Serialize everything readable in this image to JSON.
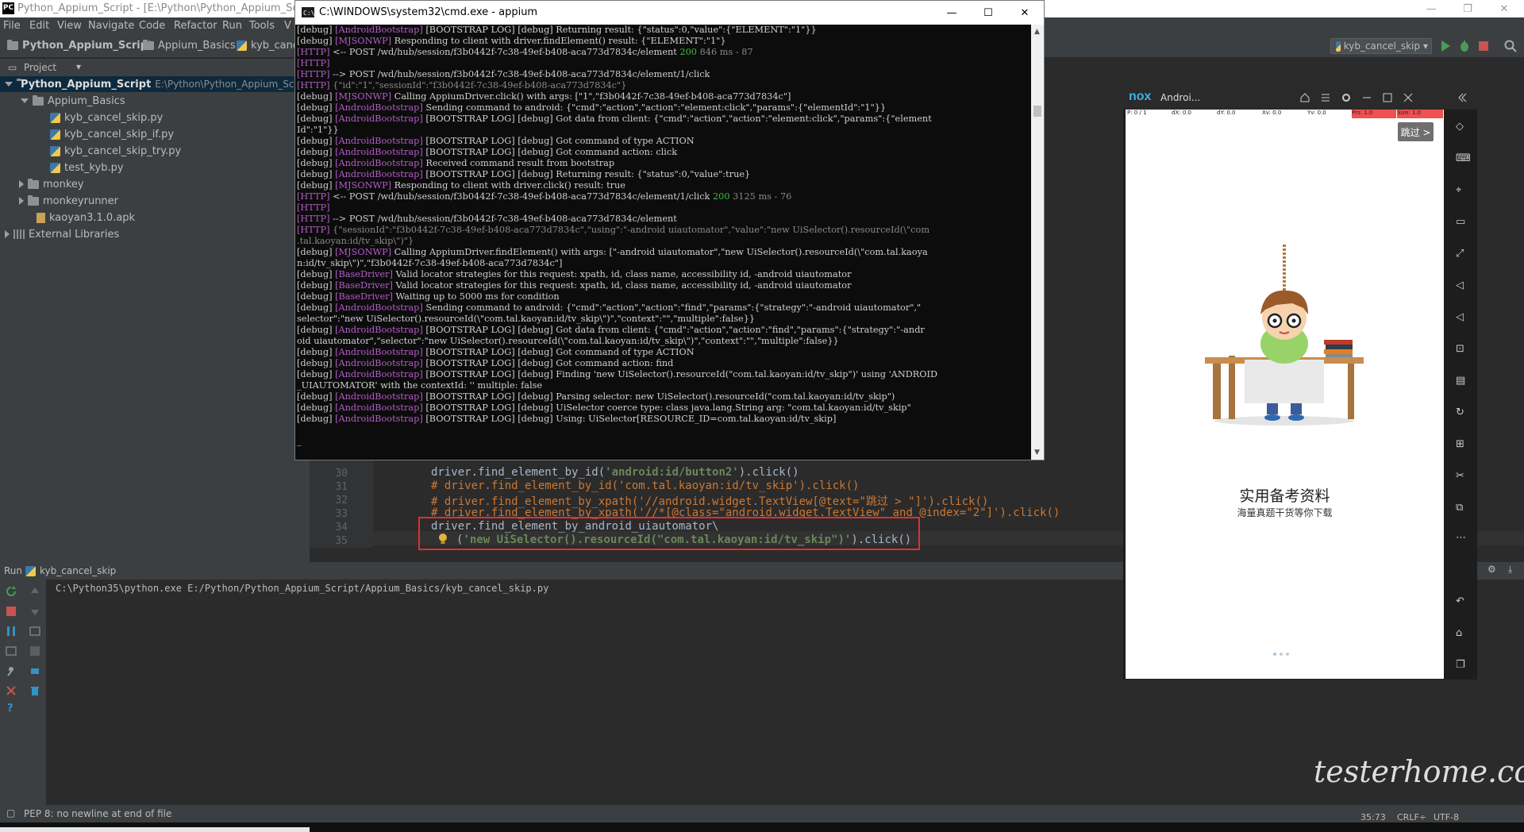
{
  "ide": {
    "title": "Python_Appium_Script - [E:\\Python\\Python_Appium_Script] - ...",
    "menu": [
      "File",
      "Edit",
      "View",
      "Navigate",
      "Code",
      "Refactor",
      "Run",
      "Tools",
      "V"
    ],
    "breadcrumbs": [
      "Python_Appium_Script",
      "Appium_Basics",
      "kyb_cance"
    ],
    "run_config": "kyb_cancel_skip",
    "project_label": "Project",
    "tree": {
      "root_name": "Python_Appium_Script",
      "root_path": "E:\\Python\\Python_Appium_Script",
      "folder1": "Appium_Basics",
      "files": [
        "kyb_cancel_skip.py",
        "kyb_cancel_skip_if.py",
        "kyb_cancel_skip_try.py",
        "test_kyb.py"
      ],
      "folder2": "monkey",
      "folder3": "monkeyrunner",
      "apk": "kaoyan3.1.0.apk",
      "external": "External Libraries"
    },
    "editor": {
      "line_numbers": [
        "30",
        "31",
        "32",
        "33",
        "34",
        "35"
      ],
      "line30_a": "driver.find_element_by_id(",
      "line30_str": "'android:id/button2'",
      "line30_b": ").click()",
      "line31": "# driver.find_element_by_id('com.tal.kaoyan:id/tv_skip').click()",
      "line32": "# driver.find_element_by_xpath('//android.widget.TextView[@text=\"跳过 > \"]').click()",
      "line33": "# driver.find_element_by_xpath('//*[@class=\"android.widget.TextView\" and @index=\"2\"]').click()",
      "line34": "driver.find_element_by_android_uiautomator\\",
      "line35_a": "(",
      "line35_str": "'new UiSelector().resourceId(\"com.tal.kaoyan:id/tv_skip\")'",
      "line35_b": ").click()"
    },
    "run": {
      "label": "Run",
      "config": "kyb_cancel_skip",
      "output": "C:\\Python35\\python.exe E:/Python/Python_Appium_Script/Appium_Basics/kyb_cancel_skip.py"
    },
    "status": {
      "message": "PEP 8: no newline at end of file",
      "position": "35:73",
      "line_sep": "CRLF÷",
      "encoding": "UTF-8"
    }
  },
  "cmd": {
    "title": "C:\\WINDOWS\\system32\\cmd.exe - appium",
    "lines": [
      [
        [
          "w",
          "[debug] "
        ],
        [
          "m",
          "[AndroidBootstrap]"
        ],
        [
          "w",
          " [BOOTSTRAP LOG] [debug] Returning result: {\"status\":0,\"value\":{\"ELEMENT\":\"1\"}}"
        ]
      ],
      [
        [
          "w",
          "[debug] "
        ],
        [
          "m",
          "[MJSONWP]"
        ],
        [
          "w",
          " Responding to client with driver.findElement() result: {\"ELEMENT\":\"1\"}"
        ]
      ],
      [
        [
          "m",
          "[HTTP]"
        ],
        [
          "w",
          " <-- POST /wd/hub/session/f3b0442f-7c38-49ef-b408-aca773d7834c/element "
        ],
        [
          "g",
          "200"
        ],
        [
          "d",
          " 846 ms - 87"
        ]
      ],
      [
        [
          "m",
          "[HTTP]"
        ]
      ],
      [
        [
          "m",
          "[HTTP]"
        ],
        [
          "w",
          " --> POST /wd/hub/session/f3b0442f-7c38-49ef-b408-aca773d7834c/element/1/click"
        ]
      ],
      [
        [
          "m",
          "[HTTP]"
        ],
        [
          "d",
          " {\"id\":\"1\",\"sessionId\":\"f3b0442f-7c38-49ef-b408-aca773d7834c\"}"
        ]
      ],
      [
        [
          "w",
          "[debug] "
        ],
        [
          "m",
          "[MJSONWP]"
        ],
        [
          "w",
          " Calling AppiumDriver.click() with args: [\"1\",\"f3b0442f-7c38-49ef-b408-aca773d7834c\"]"
        ]
      ],
      [
        [
          "w",
          "[debug] "
        ],
        [
          "m",
          "[AndroidBootstrap]"
        ],
        [
          "w",
          " Sending command to android: {\"cmd\":\"action\",\"action\":\"element:click\",\"params\":{\"elementId\":\"1\"}}"
        ]
      ],
      [
        [
          "w",
          "[debug] "
        ],
        [
          "m",
          "[AndroidBootstrap]"
        ],
        [
          "w",
          " [BOOTSTRAP LOG] [debug] Got data from client: {\"cmd\":\"action\",\"action\":\"element:click\",\"params\":{\"element"
        ]
      ],
      [
        [
          "w",
          "Id\":\"1\"}}"
        ]
      ],
      [
        [
          "w",
          "[debug] "
        ],
        [
          "m",
          "[AndroidBootstrap]"
        ],
        [
          "w",
          " [BOOTSTRAP LOG] [debug] Got command of type ACTION"
        ]
      ],
      [
        [
          "w",
          "[debug] "
        ],
        [
          "m",
          "[AndroidBootstrap]"
        ],
        [
          "w",
          " [BOOTSTRAP LOG] [debug] Got command action: click"
        ]
      ],
      [
        [
          "w",
          "[debug] "
        ],
        [
          "m",
          "[AndroidBootstrap]"
        ],
        [
          "w",
          " Received command result from bootstrap"
        ]
      ],
      [
        [
          "w",
          "[debug] "
        ],
        [
          "m",
          "[AndroidBootstrap]"
        ],
        [
          "w",
          " [BOOTSTRAP LOG] [debug] Returning result: {\"status\":0,\"value\":true}"
        ]
      ],
      [
        [
          "w",
          "[debug] "
        ],
        [
          "m",
          "[MJSONWP]"
        ],
        [
          "w",
          " Responding to client with driver.click() result: true"
        ]
      ],
      [
        [
          "m",
          "[HTTP]"
        ],
        [
          "w",
          " <-- POST /wd/hub/session/f3b0442f-7c38-49ef-b408-aca773d7834c/element/1/click "
        ],
        [
          "g",
          "200"
        ],
        [
          "d",
          " 3125 ms - 76"
        ]
      ],
      [
        [
          "m",
          "[HTTP]"
        ]
      ],
      [
        [
          "m",
          "[HTTP]"
        ],
        [
          "w",
          " --> POST /wd/hub/session/f3b0442f-7c38-49ef-b408-aca773d7834c/element"
        ]
      ],
      [
        [
          "m",
          "[HTTP]"
        ],
        [
          "d",
          " {\"sessionId\":\"f3b0442f-7c38-49ef-b408-aca773d7834c\",\"using\":\"-android uiautomator\",\"value\":\"new UiSelector().resourceId(\\\"com"
        ]
      ],
      [
        [
          "d",
          ".tal.kaoyan:id/tv_skip\\\")\"}"
        ]
      ],
      [
        [
          "w",
          "[debug] "
        ],
        [
          "m",
          "[MJSONWP]"
        ],
        [
          "w",
          " Calling AppiumDriver.findElement() with args: [\"-android uiautomator\",\"new UiSelector().resourceId(\\\"com.tal.kaoya"
        ]
      ],
      [
        [
          "w",
          "n:id/tv_skip\\\")\",\"f3b0442f-7c38-49ef-b408-aca773d7834c\"]"
        ]
      ],
      [
        [
          "w",
          "[debug] "
        ],
        [
          "m",
          "[BaseDriver]"
        ],
        [
          "w",
          " Valid locator strategies for this request: xpath, id, class name, accessibility id, -android uiautomator"
        ]
      ],
      [
        [
          "w",
          "[debug] "
        ],
        [
          "m",
          "[BaseDriver]"
        ],
        [
          "w",
          " Valid locator strategies for this request: xpath, id, class name, accessibility id, -android uiautomator"
        ]
      ],
      [
        [
          "w",
          "[debug] "
        ],
        [
          "m",
          "[BaseDriver]"
        ],
        [
          "w",
          " Waiting up to 5000 ms for condition"
        ]
      ],
      [
        [
          "w",
          "[debug] "
        ],
        [
          "m",
          "[AndroidBootstrap]"
        ],
        [
          "w",
          " Sending command to android: {\"cmd\":\"action\",\"action\":\"find\",\"params\":{\"strategy\":\"-android uiautomator\",\""
        ]
      ],
      [
        [
          "w",
          "selector\":\"new UiSelector().resourceId(\\\"com.tal.kaoyan:id/tv_skip\\\")\",\"context\":\"\",\"multiple\":false}}"
        ]
      ],
      [
        [
          "w",
          "[debug] "
        ],
        [
          "m",
          "[AndroidBootstrap]"
        ],
        [
          "w",
          " [BOOTSTRAP LOG] [debug] Got data from client: {\"cmd\":\"action\",\"action\":\"find\",\"params\":{\"strategy\":\"-andr"
        ]
      ],
      [
        [
          "w",
          "oid uiautomator\",\"selector\":\"new UiSelector().resourceId(\\\"com.tal.kaoyan:id/tv_skip\\\")\",\"context\":\"\",\"multiple\":false}}"
        ]
      ],
      [
        [
          "w",
          "[debug] "
        ],
        [
          "m",
          "[AndroidBootstrap]"
        ],
        [
          "w",
          " [BOOTSTRAP LOG] [debug] Got command of type ACTION"
        ]
      ],
      [
        [
          "w",
          "[debug] "
        ],
        [
          "m",
          "[AndroidBootstrap]"
        ],
        [
          "w",
          " [BOOTSTRAP LOG] [debug] Got command action: find"
        ]
      ],
      [
        [
          "w",
          "[debug] "
        ],
        [
          "m",
          "[AndroidBootstrap]"
        ],
        [
          "w",
          " [BOOTSTRAP LOG] [debug] Finding 'new UiSelector().resourceId(\"com.tal.kaoyan:id/tv_skip\")' using 'ANDROID"
        ]
      ],
      [
        [
          "w",
          "_UIAUTOMATOR' with the contextId: '' multiple: false"
        ]
      ],
      [
        [
          "w",
          "[debug] "
        ],
        [
          "m",
          "[AndroidBootstrap]"
        ],
        [
          "w",
          " [BOOTSTRAP LOG] [debug] Parsing selector: new UiSelector().resourceId(\"com.tal.kaoyan:id/tv_skip\")"
        ]
      ],
      [
        [
          "w",
          "[debug] "
        ],
        [
          "m",
          "[AndroidBootstrap]"
        ],
        [
          "w",
          " [BOOTSTRAP LOG] [debug] UiSelector coerce type: class java.lang.String arg: \"com.tal.kaoyan:id/tv_skip\""
        ]
      ],
      [
        [
          "w",
          "[debug] "
        ],
        [
          "m",
          "[AndroidBootstrap]"
        ],
        [
          "w",
          " [BOOTSTRAP LOG] [debug] Using: UiSelector[RESOURCE_ID=com.tal.kaoyan:id/tv_skip]"
        ]
      ],
      [
        [
          "w",
          ""
        ]
      ],
      [
        [
          "w",
          "_"
        ]
      ]
    ]
  },
  "nox": {
    "logo": "nox",
    "title": "Androi...",
    "devbar": [
      "P: 0 / 1",
      "dX: 0.0",
      "dY: 0.0",
      "Xv: 0.0",
      "Yv: 0.0",
      "Prs: 1.0",
      "Size: 1.0"
    ],
    "skip_label": "跳过 >",
    "headline": "实用备考资料",
    "subline": "海量真题干货等你下载"
  },
  "watermark": "testerhome.com",
  "colors": {
    "accent_red": "#e03030",
    "console_magenta": "#b55cc8",
    "console_green": "#39c039"
  }
}
